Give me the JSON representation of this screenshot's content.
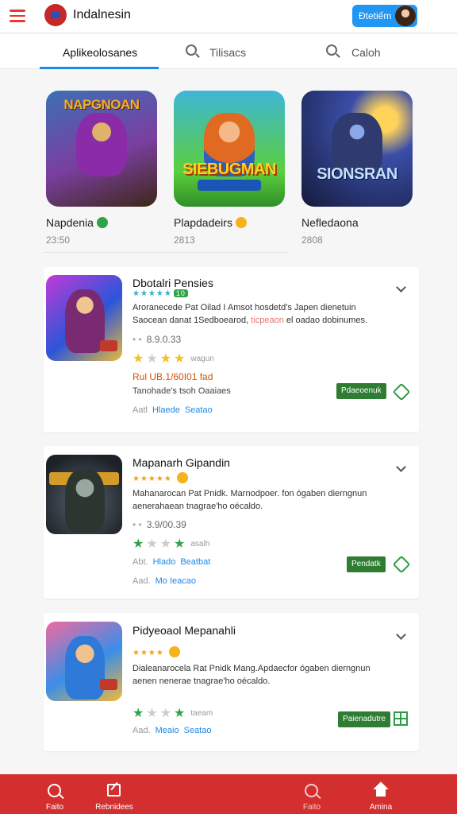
{
  "header": {
    "app_title": "Indalnesin",
    "account_label": "Đtetiếm"
  },
  "tabs": [
    {
      "label": "Aplikeolosanes"
    },
    {
      "label": "Tilisacs"
    },
    {
      "label": "Caloh"
    }
  ],
  "featured": [
    {
      "name": "Napdenia",
      "meta": "23:50",
      "art_text": "NAPGNOAN"
    },
    {
      "name": "Plapdadeirs",
      "meta": "2813",
      "art_text": "SIEBUGMAN"
    },
    {
      "name": "Nefledaona",
      "meta": "2808",
      "art_text": "SIONSRAN"
    }
  ],
  "cards": [
    {
      "title": "Dbotalri Pensies",
      "rating_badge": "10",
      "desc_line1": "Aroranecede Pat Oilad I Amsot hosdetd's Japen dienetuin",
      "desc_line2_a": "Saocean danat 1Sedboearod,",
      "desc_line2_hl": "ticpeaon",
      "desc_line2_b": "el oadao dobinumes.",
      "id": "8.9.0.33",
      "stars_label": "wagun",
      "price": "Rul UB.1/60I01 fad",
      "sub": "Tanohade's tsoh Oaaiaes",
      "link_prefix": "Aatl",
      "link_a": "Hlaede",
      "link_b": "Seatao",
      "install_label": "Pdaeoenuk"
    },
    {
      "title": "Mapanarh Gipandin",
      "desc_line1": "Mahanarocan Pat Pnidk. Marnodpoer. fon ógaben dierngnun",
      "desc_line2": "aenerahaean tnagrae'ho oécaldo.",
      "id": "3.9/00.39",
      "stars_label": "asalh",
      "link_prefix": "Abt.",
      "link_a": "Hlado",
      "link_b": "Beatbat",
      "link_c_prefix": "Aad.",
      "link_c": "Mo Ieacao",
      "install_label": "Pendatk"
    },
    {
      "title": "Pidyeoaol Mepanahli",
      "desc_line1": "Dialeanarocela Rat Pnidk Mang.Apdaecfor ógaben dierngnun",
      "desc_line2": "aenen nenerae tnagrae'ho oécaldo.",
      "stars_label": "taeam",
      "link_prefix": "Aad.",
      "link_a": "Meaio",
      "link_b": "Seatao",
      "install_label": "Paienadutre"
    }
  ],
  "bottom_nav": [
    {
      "label": "Faito"
    },
    {
      "label": "Rebnidees"
    },
    {
      "label": "Faito"
    },
    {
      "label": "Amina"
    }
  ]
}
